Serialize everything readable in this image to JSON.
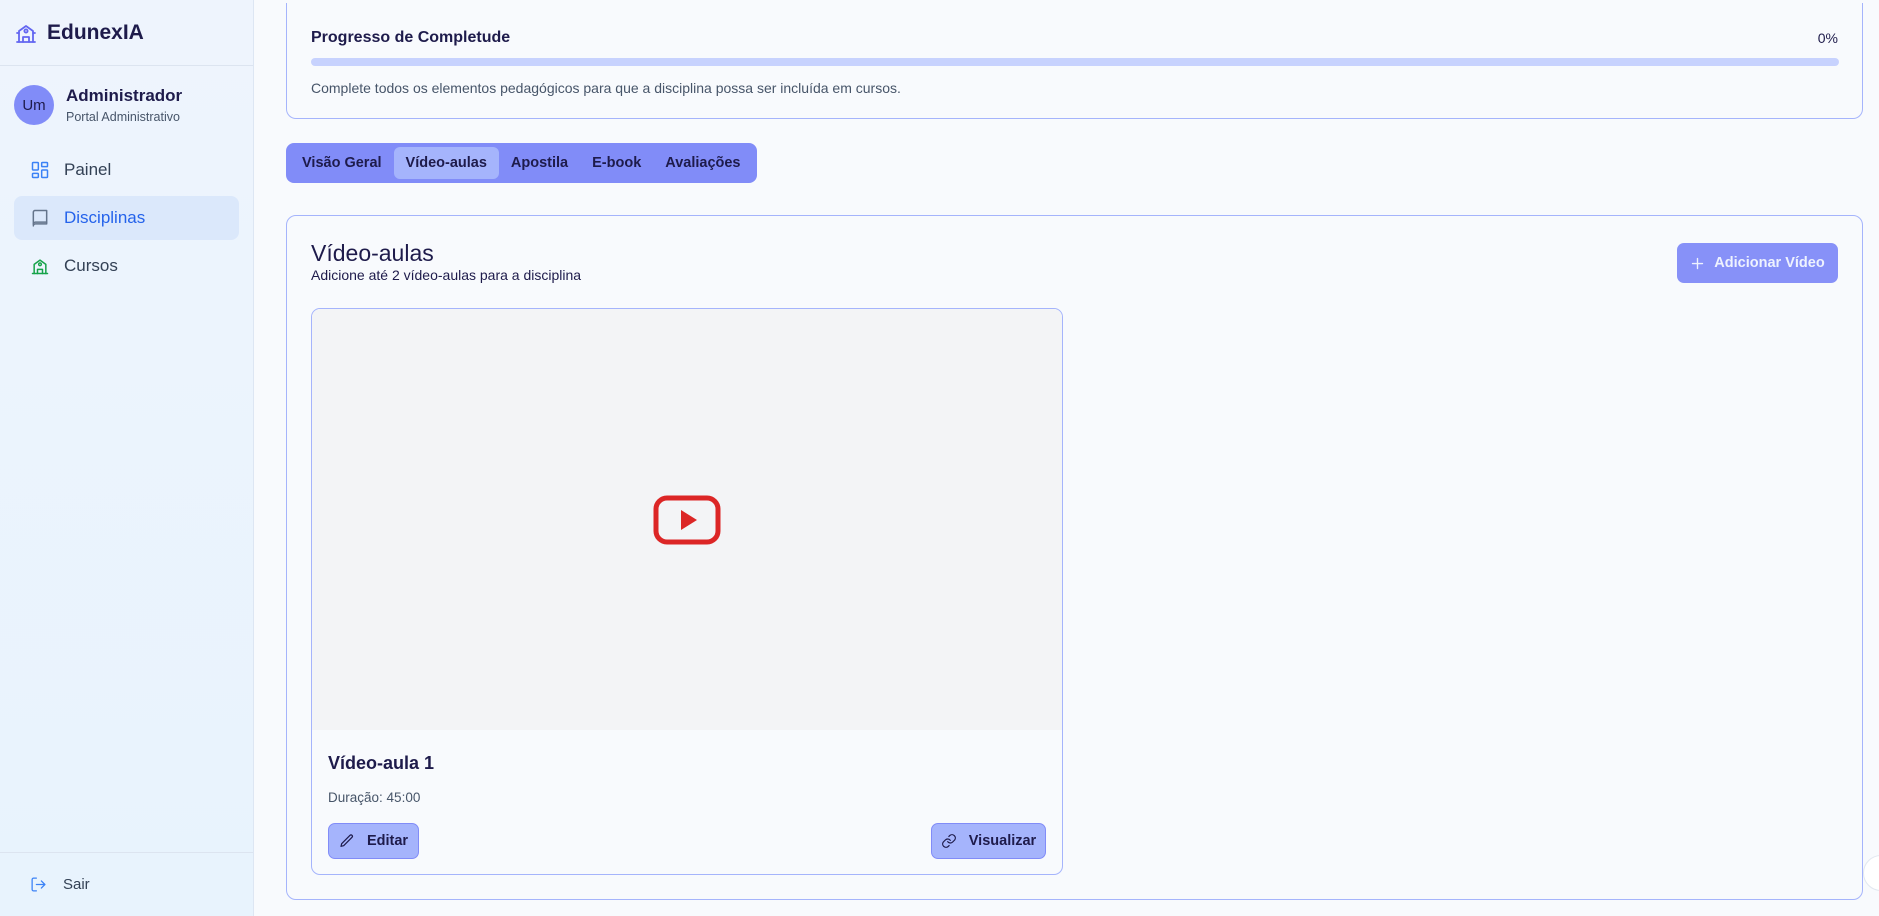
{
  "brand": {
    "name": "EdunexIA",
    "icon": "school-icon"
  },
  "user": {
    "initials": "Um",
    "name": "Administrador",
    "role": "Portal Administrativo"
  },
  "nav": {
    "items": [
      {
        "label": "Painel",
        "icon": "dashboard-icon",
        "active": false
      },
      {
        "label": "Disciplinas",
        "icon": "book-icon",
        "active": true
      },
      {
        "label": "Cursos",
        "icon": "school-icon",
        "active": false
      }
    ],
    "logout_label": "Sair"
  },
  "progress": {
    "title": "Progresso de Completude",
    "percent_label": "0%",
    "value": 0,
    "description": "Complete todos os elementos pedagógicos para que a disciplina possa ser incluída em cursos."
  },
  "tabs": [
    {
      "label": "Visão Geral",
      "active": false
    },
    {
      "label": "Vídeo-aulas",
      "active": true
    },
    {
      "label": "Apostila",
      "active": false
    },
    {
      "label": "E-book",
      "active": false
    },
    {
      "label": "Avaliações",
      "active": false
    }
  ],
  "section": {
    "title": "Vídeo-aulas",
    "subtitle": "Adicione até 2 vídeo-aulas para a disciplina",
    "add_button_label": "Adicionar Vídeo"
  },
  "video": {
    "title": "Vídeo-aula 1",
    "duration_label": "Duração:",
    "duration_value": "45:00",
    "edit_label": "Editar",
    "view_label": "Visualizar",
    "thumbnail_icon": "youtube-icon"
  },
  "colors": {
    "accent": "#818cf8",
    "accent_light": "#a5b4fc",
    "active_nav": "#2563eb",
    "youtube_red": "#dc2626",
    "cursos_icon_green": "#16a34a"
  }
}
